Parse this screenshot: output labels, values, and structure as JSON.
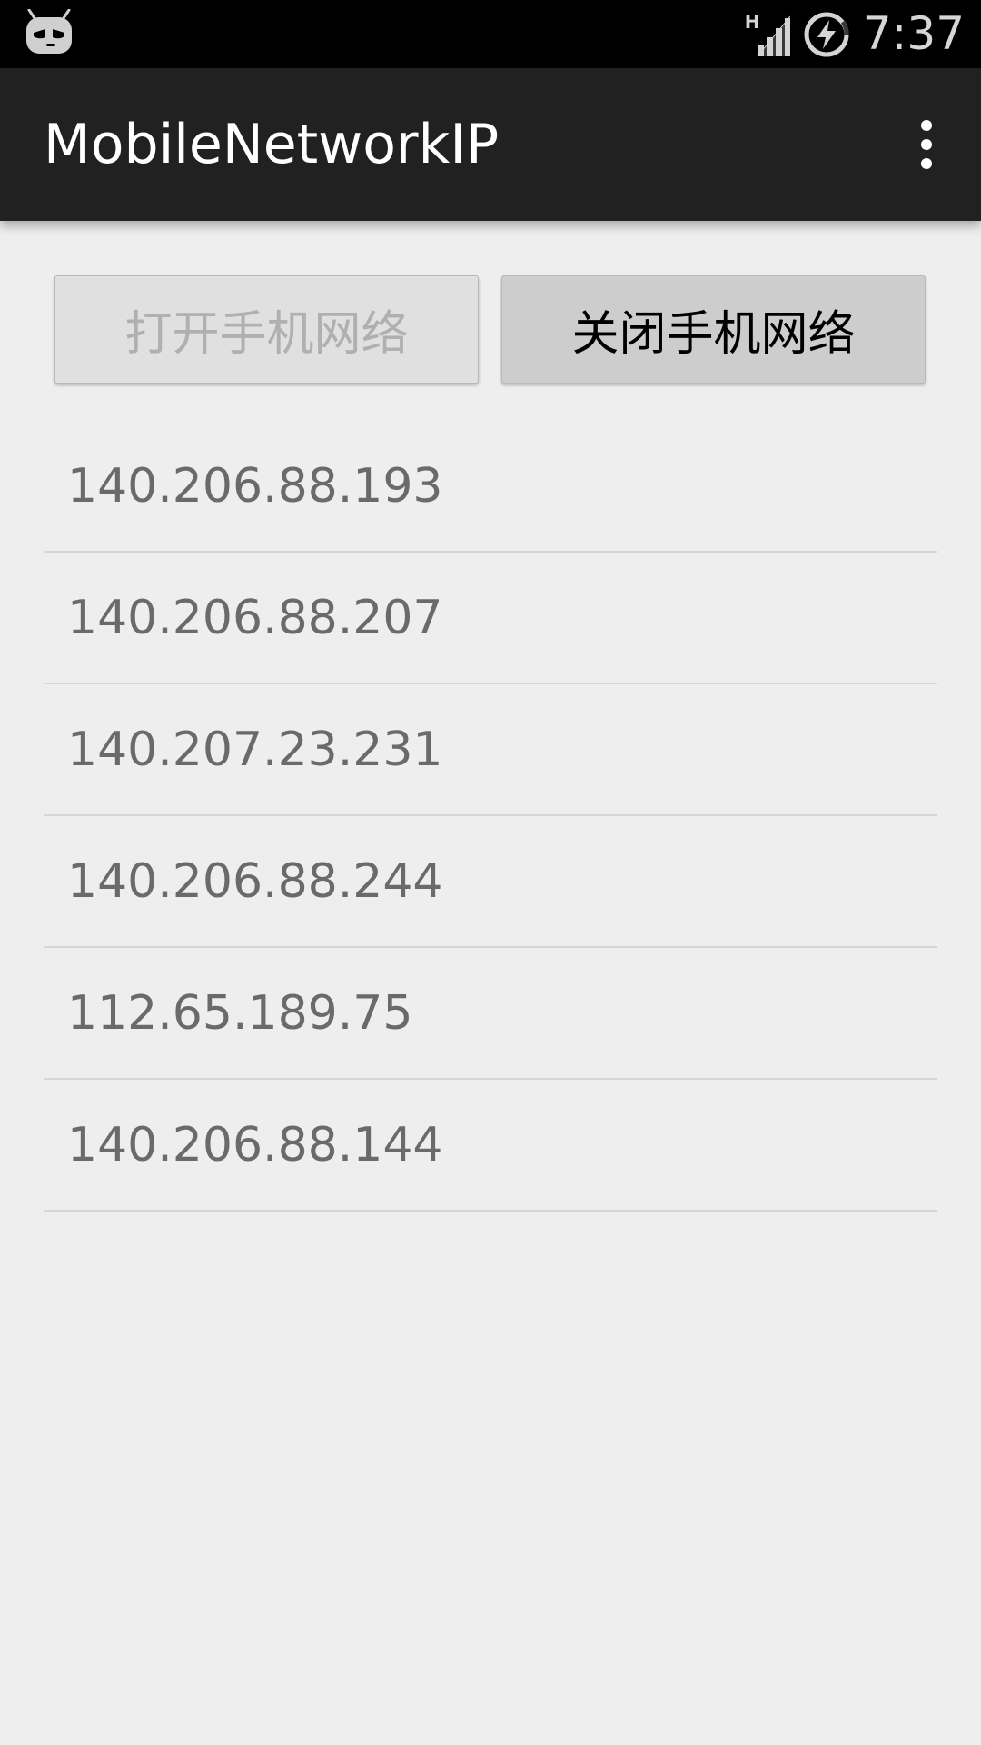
{
  "status_bar": {
    "left_icon": "cyanogenmod-bot-icon",
    "network_type": "H",
    "signal_icon": "cell-signal-icon",
    "battery_icon": "battery-charging-icon",
    "time": "7:37"
  },
  "action_bar": {
    "title": "MobileNetworkIP",
    "overflow_icon": "more-vertical-icon"
  },
  "buttons": {
    "open_label": "打开手机网络",
    "open_enabled": false,
    "close_label": "关闭手机网络",
    "close_enabled": true
  },
  "ip_list": [
    "140.206.88.193",
    "140.206.88.207",
    "140.207.23.231",
    "140.206.88.244",
    "112.65.189.75",
    "140.206.88.144"
  ],
  "colors": {
    "status_bar_bg": "#000000",
    "action_bar_bg": "#212121",
    "page_bg": "#eeeeee",
    "disabled_text": "#b0b0b0",
    "list_text": "#6a6a6a"
  }
}
